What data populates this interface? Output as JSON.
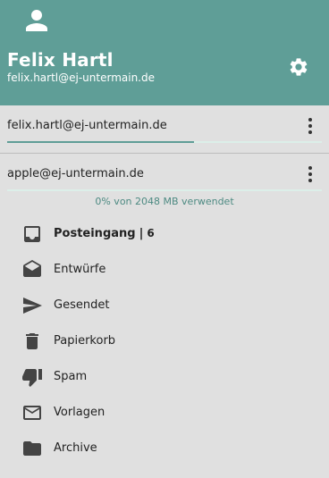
{
  "header": {
    "user_name": "Felix Hartl",
    "user_email": "felix.hartl@ej-untermain.de",
    "background_color": "#5f9e97",
    "avatar_icon": "person-icon",
    "settings_icon": "gear-icon"
  },
  "accounts": [
    {
      "label": "felix.hartl@ej-untermain.de",
      "active": true,
      "menu_icon": "more-vert-icon"
    },
    {
      "label": "apple@ej-untermain.de",
      "active": false,
      "menu_icon": "more-vert-icon"
    }
  ],
  "quota": {
    "text": "0% von 2048 MB verwendet",
    "used_fraction": 0.0
  },
  "folders": [
    {
      "label": "Posteingang",
      "icon": "inbox-icon",
      "unread": "6",
      "bold": true
    },
    {
      "label": "Entwürfe",
      "icon": "drafts-icon"
    },
    {
      "label": "Gesendet",
      "icon": "send-icon"
    },
    {
      "label": "Papierkorb",
      "icon": "trash-icon"
    },
    {
      "label": "Spam",
      "icon": "thumb-down-icon"
    },
    {
      "label": "Vorlagen",
      "icon": "mail-template-icon"
    },
    {
      "label": "Archive",
      "icon": "folder-icon"
    }
  ]
}
